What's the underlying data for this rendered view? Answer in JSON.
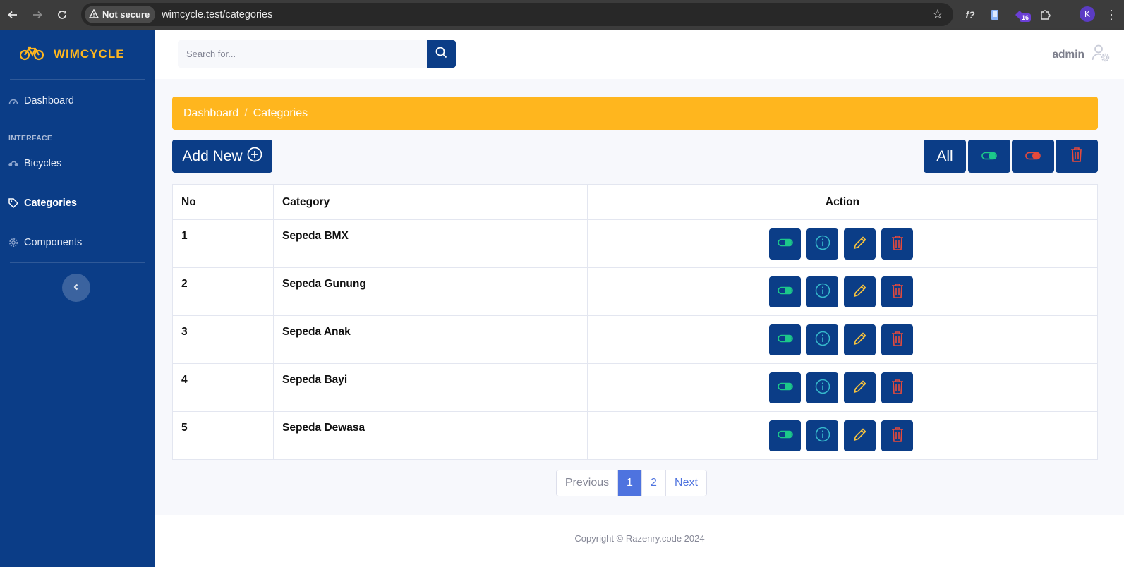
{
  "browser": {
    "security_label": "Not secure",
    "url": "wimcycle.test/categories",
    "extension_badge": "16",
    "profile_initial": "K"
  },
  "sidebar": {
    "brand": "WIMCYCLE",
    "items": [
      {
        "label": "Dashboard",
        "icon": "gauge-icon"
      },
      {
        "label": "Bicycles",
        "icon": "bicycle-icon"
      },
      {
        "label": "Categories",
        "icon": "tag-icon",
        "active": true
      },
      {
        "label": "Components",
        "icon": "gear-icon"
      }
    ],
    "heading": "INTERFACE"
  },
  "topbar": {
    "search_placeholder": "Search for...",
    "username": "admin"
  },
  "breadcrumb": {
    "items": [
      "Dashboard",
      "Categories"
    ],
    "separator": "/"
  },
  "toolbar": {
    "add_label": "Add New",
    "filter_all_label": "All"
  },
  "table": {
    "headers": [
      "No",
      "Category",
      "Action"
    ],
    "rows": [
      {
        "no": "1",
        "category": "Sepeda BMX"
      },
      {
        "no": "2",
        "category": "Sepeda Gunung"
      },
      {
        "no": "3",
        "category": "Sepeda Anak"
      },
      {
        "no": "4",
        "category": "Sepeda Bayi"
      },
      {
        "no": "5",
        "category": "Sepeda Dewasa"
      }
    ]
  },
  "pagination": {
    "previous": "Previous",
    "pages": [
      "1",
      "2"
    ],
    "current": "1",
    "next": "Next"
  },
  "footer": {
    "copyright": "Copyright © Razenry.code 2024"
  },
  "colors": {
    "primary": "#0b3d87",
    "accent": "#ffb61e",
    "success": "#1cc88a",
    "info": "#36b9cc",
    "warning": "#f6c23e",
    "danger": "#e74a3b"
  }
}
